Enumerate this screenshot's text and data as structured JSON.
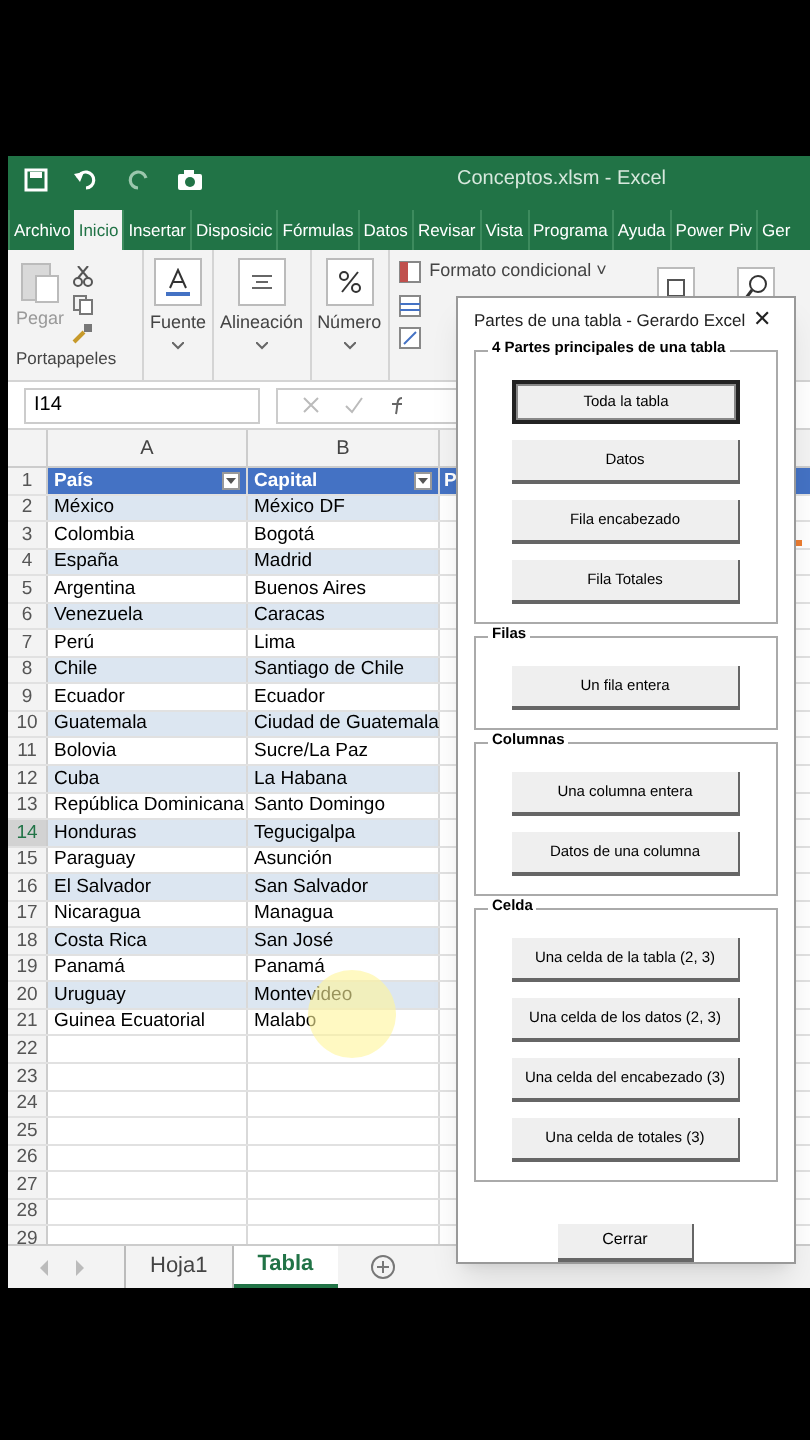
{
  "window": {
    "title": "Conceptos.xlsm - Excel"
  },
  "ribbon_tabs": [
    {
      "label": "Archivo",
      "selected": false
    },
    {
      "label": "Inicio",
      "selected": true
    },
    {
      "label": "Insertar",
      "selected": false
    },
    {
      "label": "Disposicic",
      "selected": false
    },
    {
      "label": "Fórmulas",
      "selected": false
    },
    {
      "label": "Datos",
      "selected": false
    },
    {
      "label": "Revisar",
      "selected": false
    },
    {
      "label": "Vista",
      "selected": false
    },
    {
      "label": "Programa",
      "selected": false
    },
    {
      "label": "Ayuda",
      "selected": false
    },
    {
      "label": "Power Piv",
      "selected": false
    },
    {
      "label": "Ger",
      "selected": false
    }
  ],
  "ribbon": {
    "paste": "Pegar",
    "clipboard_group": "Portapapeles",
    "font": "Fuente",
    "alignment": "Alineación",
    "number": "Número",
    "conditional_format": "Formato condicional ˅"
  },
  "formula_bar": {
    "name_box": "I14"
  },
  "sheet": {
    "columns": [
      "A",
      "B"
    ],
    "column_3": "P",
    "headers": [
      "País",
      "Capital"
    ],
    "rows": [
      [
        "México",
        "México DF"
      ],
      [
        "Colombia",
        "Bogotá"
      ],
      [
        "España",
        "Madrid"
      ],
      [
        "Argentina",
        "Buenos Aires"
      ],
      [
        "Venezuela",
        "Caracas"
      ],
      [
        "Perú",
        "Lima"
      ],
      [
        "Chile",
        "Santiago de Chile"
      ],
      [
        "Ecuador",
        "Ecuador"
      ],
      [
        "Guatemala",
        "Ciudad de Guatemala"
      ],
      [
        "Bolovia",
        "Sucre/La Paz"
      ],
      [
        "Cuba",
        "La Habana"
      ],
      [
        "República Dominicana",
        "Santo Domingo"
      ],
      [
        "Honduras",
        "Tegucigalpa"
      ],
      [
        "Paraguay",
        "Asunción"
      ],
      [
        "El Salvador",
        "San Salvador"
      ],
      [
        "Nicaragua",
        "Managua"
      ],
      [
        "Costa Rica",
        "San José"
      ],
      [
        "Panamá",
        "Panamá"
      ],
      [
        "Uruguay",
        "Montevideo"
      ],
      [
        "Guinea Ecuatorial",
        "Malabo"
      ]
    ],
    "row_numbers": [
      {
        "n": "1",
        "selected": false
      },
      {
        "n": "2",
        "selected": false
      },
      {
        "n": "3",
        "selected": false
      },
      {
        "n": "4",
        "selected": false
      },
      {
        "n": "5",
        "selected": false
      },
      {
        "n": "6",
        "selected": false
      },
      {
        "n": "7",
        "selected": false
      },
      {
        "n": "8",
        "selected": false
      },
      {
        "n": "9",
        "selected": false
      },
      {
        "n": "10",
        "selected": false
      },
      {
        "n": "11",
        "selected": false
      },
      {
        "n": "12",
        "selected": false
      },
      {
        "n": "13",
        "selected": false
      },
      {
        "n": "14",
        "selected": true
      },
      {
        "n": "15",
        "selected": false
      },
      {
        "n": "16",
        "selected": false
      },
      {
        "n": "17",
        "selected": false
      },
      {
        "n": "18",
        "selected": false
      },
      {
        "n": "19",
        "selected": false
      },
      {
        "n": "20",
        "selected": false
      },
      {
        "n": "21",
        "selected": false
      },
      {
        "n": "22",
        "selected": false
      },
      {
        "n": "23",
        "selected": false
      },
      {
        "n": "24",
        "selected": false
      },
      {
        "n": "25",
        "selected": false
      },
      {
        "n": "26",
        "selected": false
      },
      {
        "n": "27",
        "selected": false
      },
      {
        "n": "28",
        "selected": false
      },
      {
        "n": "29",
        "selected": false
      }
    ]
  },
  "sheet_tabs": [
    {
      "label": "Hoja1",
      "selected": false
    },
    {
      "label": "Tabla",
      "selected": true
    }
  ],
  "dialog": {
    "title": "Partes de una tabla - Gerardo Excel",
    "close": "✕",
    "groups": [
      {
        "title": "4 Partes principales de una tabla",
        "buttons": [
          {
            "label": "Toda la tabla",
            "focused": true
          },
          {
            "label": "Datos",
            "focused": false
          },
          {
            "label": "Fila encabezado",
            "focused": false
          },
          {
            "label": "Fila Totales",
            "focused": false
          }
        ]
      },
      {
        "title": "Filas",
        "buttons": [
          {
            "label": "Un fila entera",
            "focused": false
          }
        ]
      },
      {
        "title": "Columnas",
        "buttons": [
          {
            "label": "Una columna entera",
            "focused": false
          },
          {
            "label": "Datos de una columna",
            "focused": false
          }
        ]
      },
      {
        "title": "Celda",
        "buttons": [
          {
            "label": "Una celda de la tabla (2, 3)",
            "focused": false
          },
          {
            "label": "Una celda de los datos (2, 3)",
            "focused": false
          },
          {
            "label": "Una celda del encabezado (3)",
            "focused": false
          },
          {
            "label": "Una celda de totales (3)",
            "focused": false
          }
        ]
      }
    ],
    "close_button": "Cerrar"
  }
}
